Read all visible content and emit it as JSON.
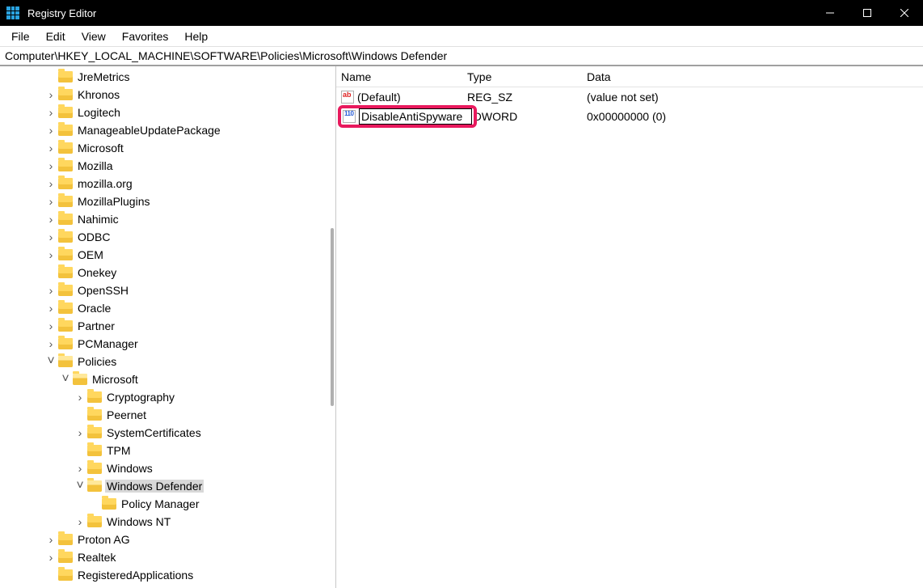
{
  "titlebar": {
    "title": "Registry Editor"
  },
  "menubar": [
    "File",
    "Edit",
    "View",
    "Favorites",
    "Help"
  ],
  "addressbar": "Computer\\HKEY_LOCAL_MACHINE\\SOFTWARE\\Policies\\Microsoft\\Windows Defender",
  "columns": {
    "name": "Name",
    "type": "Type",
    "data": "Data"
  },
  "values": [
    {
      "icon": "sz",
      "name": "(Default)",
      "type": "REG_SZ",
      "data": "(value not set)",
      "editing": false
    },
    {
      "icon": "dw",
      "name": "DisableAntiSpyware",
      "type": "REG_DWORD",
      "type_visible": "_DWORD",
      "data": "0x00000000 (0)",
      "editing": true
    }
  ],
  "tree": [
    {
      "indent": 3,
      "exp": "",
      "label": "JreMetrics"
    },
    {
      "indent": 3,
      "exp": ">",
      "label": "Khronos"
    },
    {
      "indent": 3,
      "exp": ">",
      "label": "Logitech"
    },
    {
      "indent": 3,
      "exp": ">",
      "label": "ManageableUpdatePackage"
    },
    {
      "indent": 3,
      "exp": ">",
      "label": "Microsoft"
    },
    {
      "indent": 3,
      "exp": ">",
      "label": "Mozilla"
    },
    {
      "indent": 3,
      "exp": ">",
      "label": "mozilla.org"
    },
    {
      "indent": 3,
      "exp": ">",
      "label": "MozillaPlugins"
    },
    {
      "indent": 3,
      "exp": ">",
      "label": "Nahimic"
    },
    {
      "indent": 3,
      "exp": ">",
      "label": "ODBC"
    },
    {
      "indent": 3,
      "exp": ">",
      "label": "OEM"
    },
    {
      "indent": 3,
      "exp": "",
      "label": "Onekey"
    },
    {
      "indent": 3,
      "exp": ">",
      "label": "OpenSSH"
    },
    {
      "indent": 3,
      "exp": ">",
      "label": "Oracle"
    },
    {
      "indent": 3,
      "exp": ">",
      "label": "Partner"
    },
    {
      "indent": 3,
      "exp": ">",
      "label": "PCManager"
    },
    {
      "indent": 3,
      "exp": "v",
      "label": "Policies",
      "open": true
    },
    {
      "indent": 4,
      "exp": "v",
      "label": "Microsoft",
      "open": true
    },
    {
      "indent": 5,
      "exp": ">",
      "label": "Cryptography"
    },
    {
      "indent": 5,
      "exp": "",
      "label": "Peernet"
    },
    {
      "indent": 5,
      "exp": ">",
      "label": "SystemCertificates"
    },
    {
      "indent": 5,
      "exp": "",
      "label": "TPM"
    },
    {
      "indent": 5,
      "exp": ">",
      "label": "Windows"
    },
    {
      "indent": 5,
      "exp": "v",
      "label": "Windows Defender",
      "open": true,
      "selected": true
    },
    {
      "indent": 6,
      "exp": "",
      "label": "Policy Manager"
    },
    {
      "indent": 5,
      "exp": ">",
      "label": "Windows NT"
    },
    {
      "indent": 3,
      "exp": ">",
      "label": "Proton AG"
    },
    {
      "indent": 3,
      "exp": ">",
      "label": "Realtek"
    },
    {
      "indent": 3,
      "exp": "",
      "label": "RegisteredApplications"
    }
  ]
}
